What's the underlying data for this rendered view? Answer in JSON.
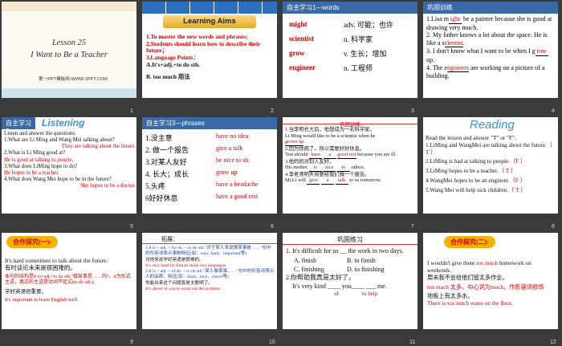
{
  "slides": [
    {
      "num": "1",
      "lesson": "Lesson 25",
      "title": "I Want to Be a Teacher",
      "site": "第一PPT模板网-WWW.1PPT.COM"
    },
    {
      "num": "2",
      "banner": "Learning Aims",
      "items": [
        "1.To master the new words and phrases;",
        "2.Students should learn how to describe their future；",
        "3.Language Points：",
        "A.It's+adj.+to do sth.",
        "B. too much 用法"
      ]
    },
    {
      "num": "3",
      "header": "自主学习1—words",
      "words": [
        {
          "w": "might",
          "d": "adv. 可能；也许"
        },
        {
          "w": "scientist",
          "d": "n. 科学家"
        },
        {
          "w": "grow",
          "d": "v. 生长；增加"
        },
        {
          "w": "engineer",
          "d": "n. 工程师"
        }
      ]
    },
    {
      "num": "4",
      "header": "巩固训练",
      "l1a": "1.Lisa m",
      "l1b": "ight",
      "l1c": " be a painter because she is good at drawing very much.",
      "l2a": "2. My father knows a lot about the space. He is like a s",
      "l2b": "cientist",
      "l2c": ".",
      "l3a": "3. I don't know what I want to be when I g",
      "l3b": "row",
      "l3c": " up.",
      "l4a": "4. The e",
      "l4b": "ngineers",
      "l4c": " are working on a picture of a building."
    },
    {
      "num": "5",
      "header": "自主学习2",
      "listen": "Listening",
      "intro": "Listen and answer the questions.",
      "q1": "1.What are Li Ming and Wang Mei talking about?",
      "a1": "They are talking about the future.",
      "q2": "2.What is Li Ming good at?",
      "a2": "He is good at talking to people.",
      "q3": "3.What does LiMing hope to do?",
      "a3": "He hopes to be a teacher.",
      "q4": "4.What does Wang Mei hope to be in the future?",
      "a4": "She hopes to be a doctor."
    },
    {
      "num": "6",
      "header": "自主学习3—phrases",
      "rows": [
        {
          "cn": "1.没主意",
          "en": "have no idea"
        },
        {
          "cn": "2. 做一个报告",
          "en": "give a talk"
        },
        {
          "cn": "3.对某人友好",
          "en": "be nice to sb."
        },
        {
          "cn": "4. 长大；成长",
          "en": "grow up"
        },
        {
          "cn": "5.头疼",
          "en": "have a headache"
        },
        {
          "cn": "6好好休息",
          "en": "have a good rest"
        }
      ]
    },
    {
      "num": "7",
      "header": "巩固训练",
      "l1": "1.当李明长大后，他想成为一名科学家。",
      "l1e": "Li Ming would like to be a scientist when he",
      "l1b": "grows up",
      "l2": "2.因为你病了，所以需要好好休息。",
      "l2e": "You should",
      "l2b1": "have",
      "l2b2": "a",
      "l2b3": "good rest",
      "l2t": "because you are ill.",
      "l3": "3.他妈妈对别人友好。",
      "l3e": "His mother",
      "l3b1": "is",
      "l3b2": "nice",
      "l3b3": "to",
      "l3t": "others.",
      "l4": "4.李老师明天将要给我们做一个报告。",
      "l4e": "Mr.Li will",
      "l4b1": "give",
      "l4b2": "a",
      "l4b3": "talk",
      "l4t": "to us tomorrow."
    },
    {
      "num": "8",
      "title": "Reading",
      "intro": "Read the lesson and answer \"T\" or \"F\".",
      "items": [
        {
          "q": "1.LiMing and WangMei are talking about the future.",
          "a": "（ T ）"
        },
        {
          "q": "2.LiMing is bad at talking to people.",
          "a": "（F ）"
        },
        {
          "q": "3.LiMing hopes to be a teacher.",
          "a": "（ T ）"
        },
        {
          "q": "4.WangMei hopes to be an engineer.",
          "a": "（F ）"
        },
        {
          "q": "5.Wang Mei will help sick children.",
          "a": "（ T ）"
        }
      ]
    },
    {
      "num": "9",
      "pill": "合作探究(一):",
      "e1": "It's hard sometimes to talk about the future.",
      "c1": "有时谈论未来是很困难的。",
      "p1": "本句的结构是it is+adj.+to do sth.\"做某事是……的\"。it为形式主语，真正的主语是动词不定式(to do sth.)。",
      "c2": "学好英语很重要。",
      "e2": "It's important to learn English well."
    },
    {
      "num": "10",
      "header": "拓展：",
      "t1": "1.It is + adj. + for sb. + to do sth.\"对于某人来说做某事是……\"句中的形容词表示事物特征(如：easy, hard，important等)",
      "t1c": "对他来说学好英语是很难的。",
      "t1e": "It's very hard for him to study two languages.",
      "t2": "2.It is + adj. + of sb. + to do sth.\"某人做某事……\"句中的形容词表示人的品质、特征(如：kind，nice，clever等)",
      "t2c": "你能出来这个问题真是太聪明了。",
      "t2e": "It's clever of you to work out the problem."
    },
    {
      "num": "11",
      "header": "巩固练习",
      "q1": "1. It's difficult for us __ the work in two days.",
      "oA": "A. finish",
      "oB": "B. to finish",
      "oC": "C. finishing",
      "oD": "D. to finishing",
      "q2": "2.你帮助我真是太好了。",
      "q2e": "It's very kind ____ you____ ___ me.",
      "a1": "of",
      "a2": "to help"
    },
    {
      "num": "12",
      "pill": "合作探究(二):",
      "e1": "I wouldn't  give them ",
      "e1r": "too much",
      "e1b": " homework on weekends.",
      "c1": "周末我不会给他们留太多作业。",
      "n1": "too much 太多，中心词为much，作形容词修饰",
      "n2": "地板上有太多水。",
      "n3": "There is too much water on the floor."
    }
  ]
}
